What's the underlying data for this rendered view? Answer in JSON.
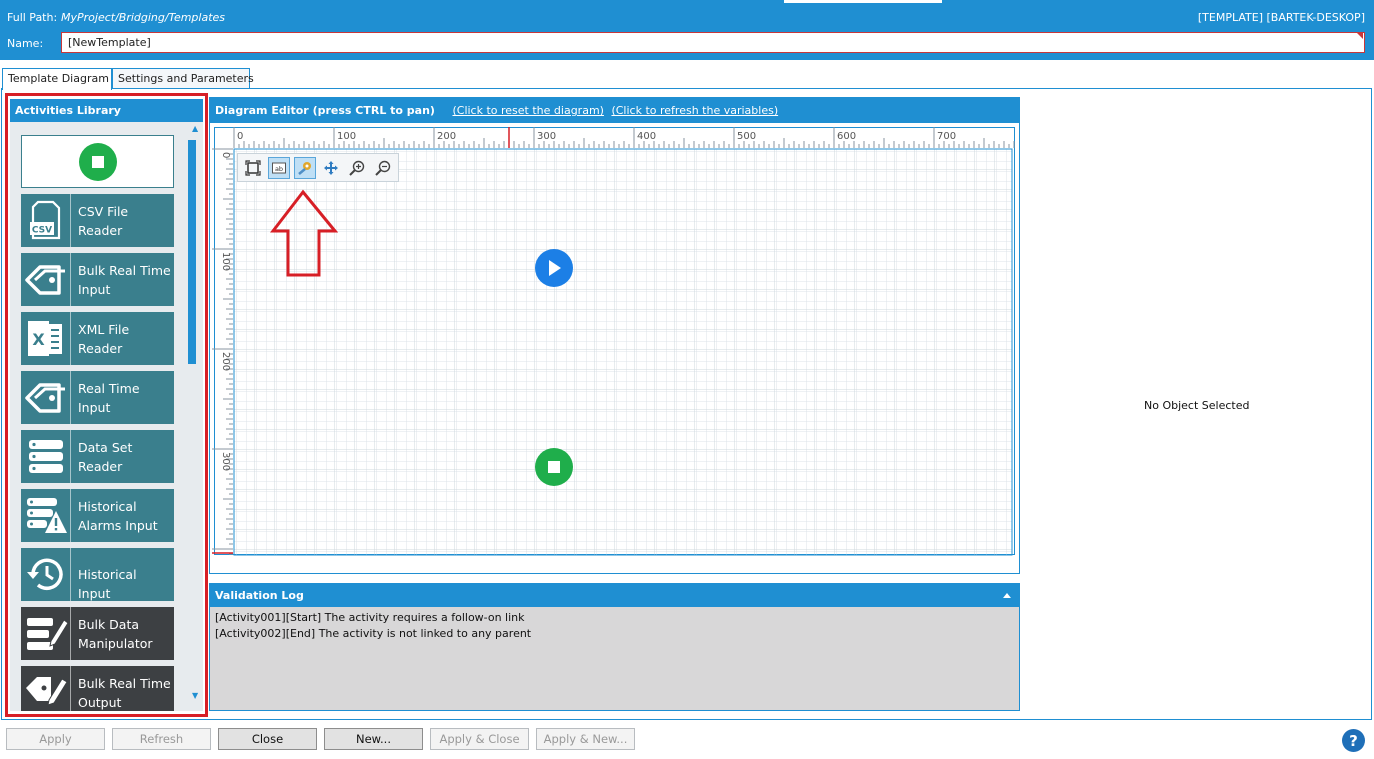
{
  "header": {
    "path_label": "Full Path:",
    "path_value": "MyProject/Bridging/Templates",
    "context": "[TEMPLATE] [BARTEK-DESKOP]",
    "name_label": "Name:",
    "name_value": "[NewTemplate]"
  },
  "tabs": [
    {
      "label": "Template Diagram",
      "active": true
    },
    {
      "label": "Settings and Parameters",
      "active": false
    }
  ],
  "library": {
    "title": "Activities Library",
    "items": [
      {
        "label": "CSV File Reader",
        "icon": "csv-file-icon",
        "group": "input"
      },
      {
        "label": "Bulk Real Time Input",
        "icon": "tag-icon",
        "group": "input"
      },
      {
        "label": "XML File Reader",
        "icon": "excel-file-icon",
        "group": "input"
      },
      {
        "label": "Real Time Input",
        "icon": "tag-icon",
        "group": "input"
      },
      {
        "label": "Data Set Reader",
        "icon": "database-icon",
        "group": "input"
      },
      {
        "label": "Historical Alarms Input",
        "icon": "alarm-database-icon",
        "group": "input"
      },
      {
        "label": "Historical Input",
        "icon": "history-icon",
        "group": "input"
      },
      {
        "label": "Bulk Data Manipulator",
        "icon": "edit-list-icon",
        "group": "process"
      },
      {
        "label": "Bulk Real Time Output",
        "icon": "edit-tag-icon",
        "group": "process"
      }
    ]
  },
  "editor": {
    "title": "Diagram Editor (press CTRL to pan)",
    "reset_link": "(Click to reset the diagram)",
    "refresh_link": "(Click to refresh the variables)",
    "ruler_h": [
      "0",
      "100",
      "200",
      "300",
      "400",
      "500",
      "600",
      "700"
    ],
    "ruler_v": [
      "0",
      "100",
      "200",
      "300"
    ],
    "toolbar": [
      "fit-to-page-icon",
      "text-label-icon",
      "link-connector-icon",
      "pan-icon",
      "zoom-in-icon",
      "zoom-out-icon"
    ]
  },
  "validation": {
    "title": "Validation Log",
    "lines": [
      "[Activity001][Start] The activity requires a follow-on link",
      "[Activity002][End] The activity is not linked to any parent"
    ]
  },
  "properties": {
    "empty_text": "No Object Selected"
  },
  "footer": {
    "buttons": [
      {
        "label": "Apply",
        "enabled": false
      },
      {
        "label": "Refresh",
        "enabled": false
      },
      {
        "label": "Close",
        "enabled": true
      },
      {
        "label": "New...",
        "enabled": true
      },
      {
        "label": "Apply & Close",
        "enabled": false
      },
      {
        "label": "Apply & New...",
        "enabled": false
      }
    ],
    "help": "?"
  },
  "colors": {
    "accent": "#1f8fd2",
    "teal": "#3a7f8d",
    "dark": "#3d4043",
    "highlight": "#d71f26",
    "start_node": "#1c7fe6",
    "end_node": "#1fae4b"
  }
}
